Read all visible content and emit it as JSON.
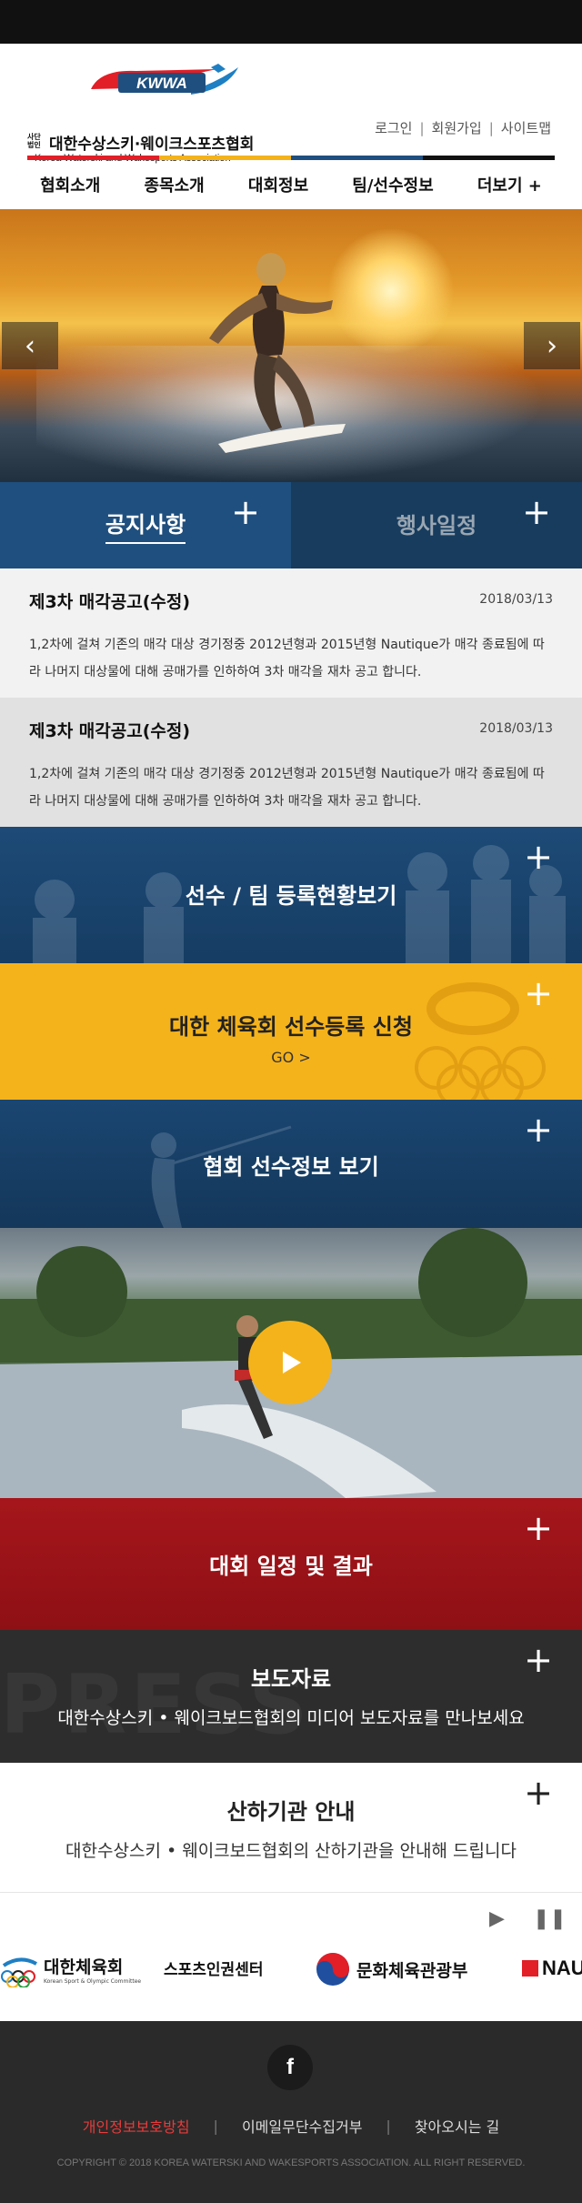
{
  "brand": {
    "logo_mark": "KWWA",
    "tag": "사단법인",
    "name_ko": "대한수상스키·웨이크스포츠협회",
    "name_en": "Korea Waterski and Wakesports Association"
  },
  "util_nav": [
    "로그인",
    "회원가입",
    "사이트맵"
  ],
  "stripe_colors": [
    "#e21e26",
    "#f5b31b",
    "#1f4f7e",
    "#111111"
  ],
  "gnb": [
    "협회소개",
    "종목소개",
    "대회정보",
    "팀/선수정보",
    "더보기 +"
  ],
  "hero": {
    "prev_icon": "chevron-left-icon",
    "next_icon": "chevron-right-icon"
  },
  "tabs": [
    {
      "label": "공지사항",
      "plus": "+"
    },
    {
      "label": "행사일정",
      "plus": "+"
    }
  ],
  "notices": [
    {
      "title": "제3차 매각공고(수정)",
      "date": "2018/03/13",
      "body": "1,2차에 걸쳐 기존의 매각 대상 경기정중 2012년형과 2015년형 Nautique가 매각 종료됨에 따라 나머지 대상물에 대해 공매가를 인하하여 3차 매각을 재차 공고 합니다."
    },
    {
      "title": "제3차 매각공고(수정)",
      "date": "2018/03/13",
      "body": "1,2차에 걸쳐 기존의 매각 대상 경기정중 2012년형과 2015년형 Nautique가 매각 종료됨에 따라 나머지 대상물에 대해 공매가를 인하하여 3차 매각을 재차 공고 합니다."
    }
  ],
  "bands": {
    "registration": {
      "title": "선수 / 팀 등록현황보기",
      "plus": "+"
    },
    "ksoc": {
      "title": "대한 체육회 선수등록 신청",
      "go": "GO >",
      "plus": "+"
    },
    "athlete_info": {
      "title": "협회 선수정보 보기",
      "plus": "+"
    },
    "competition": {
      "title": "대회 일정 및 결과",
      "plus": "+"
    },
    "press": {
      "title": "보도자료",
      "subtitle": "대한수상스키 • 웨이크보드협회의 미디어 보도자료를 만나보세요",
      "plus": "+",
      "bg_word": "PRESS"
    },
    "affiliates": {
      "title": "산하기관 안내",
      "subtitle": "대한수상스키 • 웨이크보드협회의 산하기관을 안내해 드립니다",
      "plus": "+"
    }
  },
  "video": {
    "play_icon": "play-icon"
  },
  "partners": {
    "controls": {
      "play": "▶",
      "pause": "❚❚"
    },
    "items": [
      {
        "name": "대한체육회",
        "sub": "Korean Sport & Olympic Committee"
      },
      {
        "name": "스포츠인권센터"
      },
      {
        "name": "문화체육관광부"
      },
      {
        "name": "NAU"
      }
    ]
  },
  "footer": {
    "facebook": "f",
    "links": [
      "개인정보보호방침",
      "이메일무단수집거부",
      "찾아오시는 길"
    ],
    "copyright": "COPYRIGHT © 2018 KOREA WATERSKI AND WAKESPORTS ASSOCIATION. ALL RIGHT RESERVED."
  }
}
